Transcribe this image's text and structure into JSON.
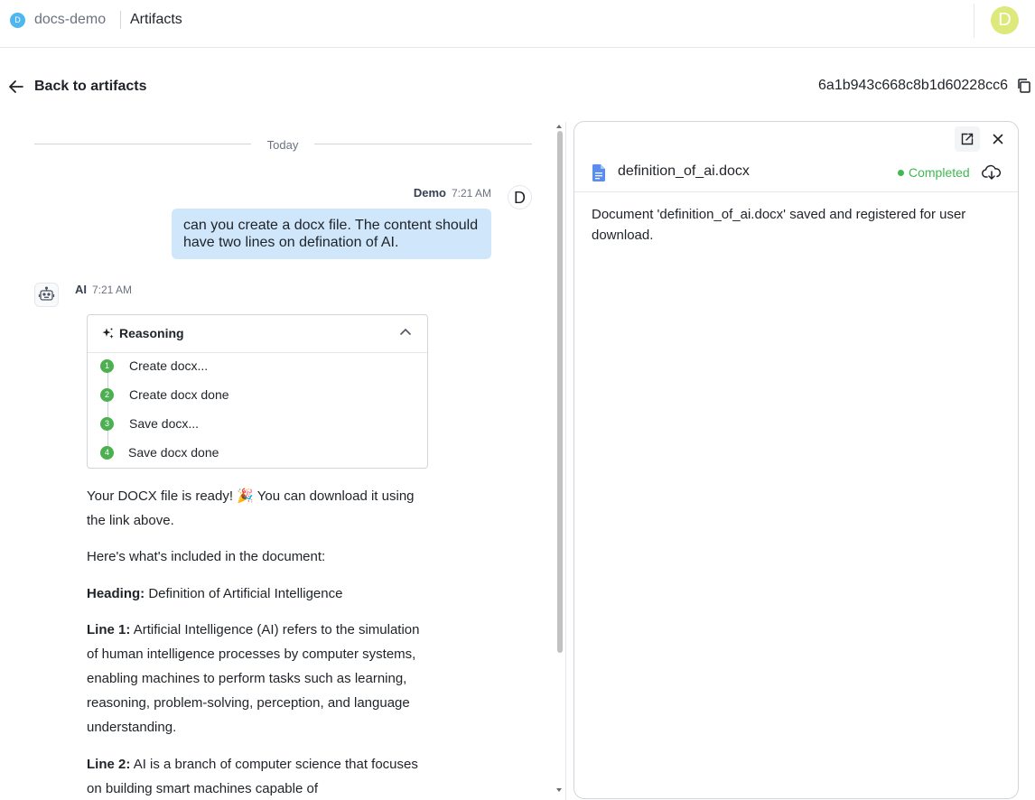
{
  "header": {
    "workspace_initial": "D",
    "workspace_name": "docs-demo",
    "current_page": "Artifacts",
    "user_avatar_initial": "D"
  },
  "subheader": {
    "back_label": "Back to artifacts",
    "artifact_id": "6a1b943c668c8b1d60228cc6"
  },
  "chat": {
    "date_divider": "Today",
    "user_message": {
      "author": "Demo",
      "time": "7:21 AM",
      "avatar_initial": "D",
      "text": "can you create a docx file. The content should have two lines on defination of AI."
    },
    "ai_message": {
      "author": "AI",
      "time": "7:21 AM",
      "reasoning_title": "Reasoning",
      "steps": [
        {
          "num": "1",
          "label": "Create docx..."
        },
        {
          "num": "2",
          "label": "Create docx done"
        },
        {
          "num": "3",
          "label": "Save docx..."
        },
        {
          "num": "4",
          "label": "Save docx done"
        }
      ],
      "intro": "Your DOCX file is ready! 🎉 You can download it using the link above.",
      "included": "Here's what's included in the document:",
      "heading_label": "Heading:",
      "heading_value": "Definition of Artificial Intelligence",
      "line1_label": "Line 1:",
      "line1_value": "Artificial Intelligence (AI) refers to the simulation of human intelligence processes by computer systems, enabling machines to perform tasks such as learning, reasoning, problem-solving, perception, and language understanding.",
      "line2_label": "Line 2:",
      "line2_value": "AI is a branch of computer science that focuses on building smart machines capable of"
    }
  },
  "artifact_panel": {
    "file_name": "definition_of_ai.docx",
    "status": "Completed",
    "body": "Document 'definition_of_ai.docx' saved and registered for user download."
  },
  "colors": {
    "user_bubble": "#cfe6fb",
    "status_green": "#3fb950",
    "step_green": "#4caf50",
    "avatar": "#dde97a",
    "workspace_badge": "#4fb6f0"
  }
}
